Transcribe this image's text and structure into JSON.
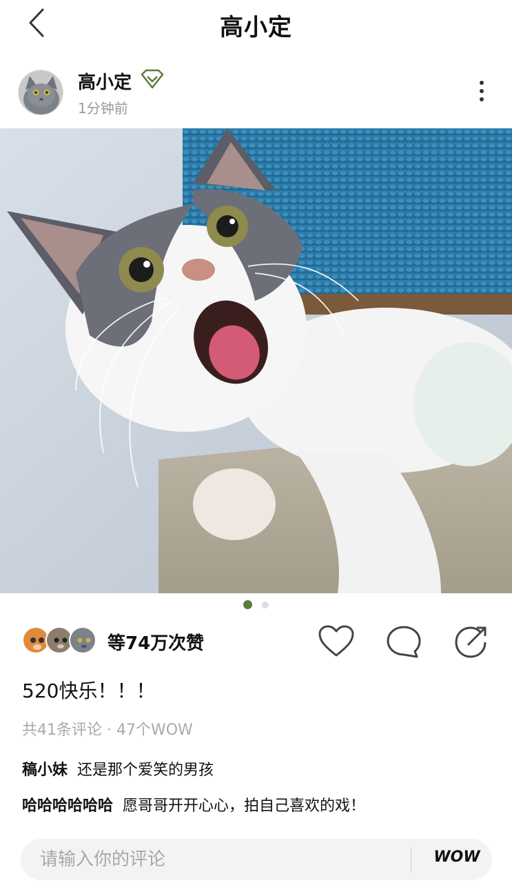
{
  "header": {
    "title": "高小定"
  },
  "author": {
    "name": "高小定",
    "time": "1分钟前"
  },
  "icons": {
    "back": "chevron-left-icon",
    "badge": "diamond-icon",
    "more": "more-vertical-icon",
    "like": "heart-icon",
    "comment": "comment-bubble-icon",
    "share": "share-arrow-icon"
  },
  "colors": {
    "accent": "#5b7a3a",
    "dot_inactive": "#dddddd",
    "muted": "#aaaaaa"
  },
  "pager": {
    "current": 1,
    "total": 2
  },
  "likes": {
    "text": "等74万次赞"
  },
  "post": {
    "caption": "520快乐！！！"
  },
  "meta": {
    "text": "共41条评论 · 47个WOW"
  },
  "comments": [
    {
      "user": "稿小妹",
      "text": "还是那个爱笑的男孩"
    },
    {
      "user": "哈哈哈哈哈哈",
      "text": "愿哥哥开开心心，拍自己喜欢的戏！"
    }
  ],
  "input": {
    "placeholder": "请输入你的评论",
    "wow_label": "WOW"
  }
}
